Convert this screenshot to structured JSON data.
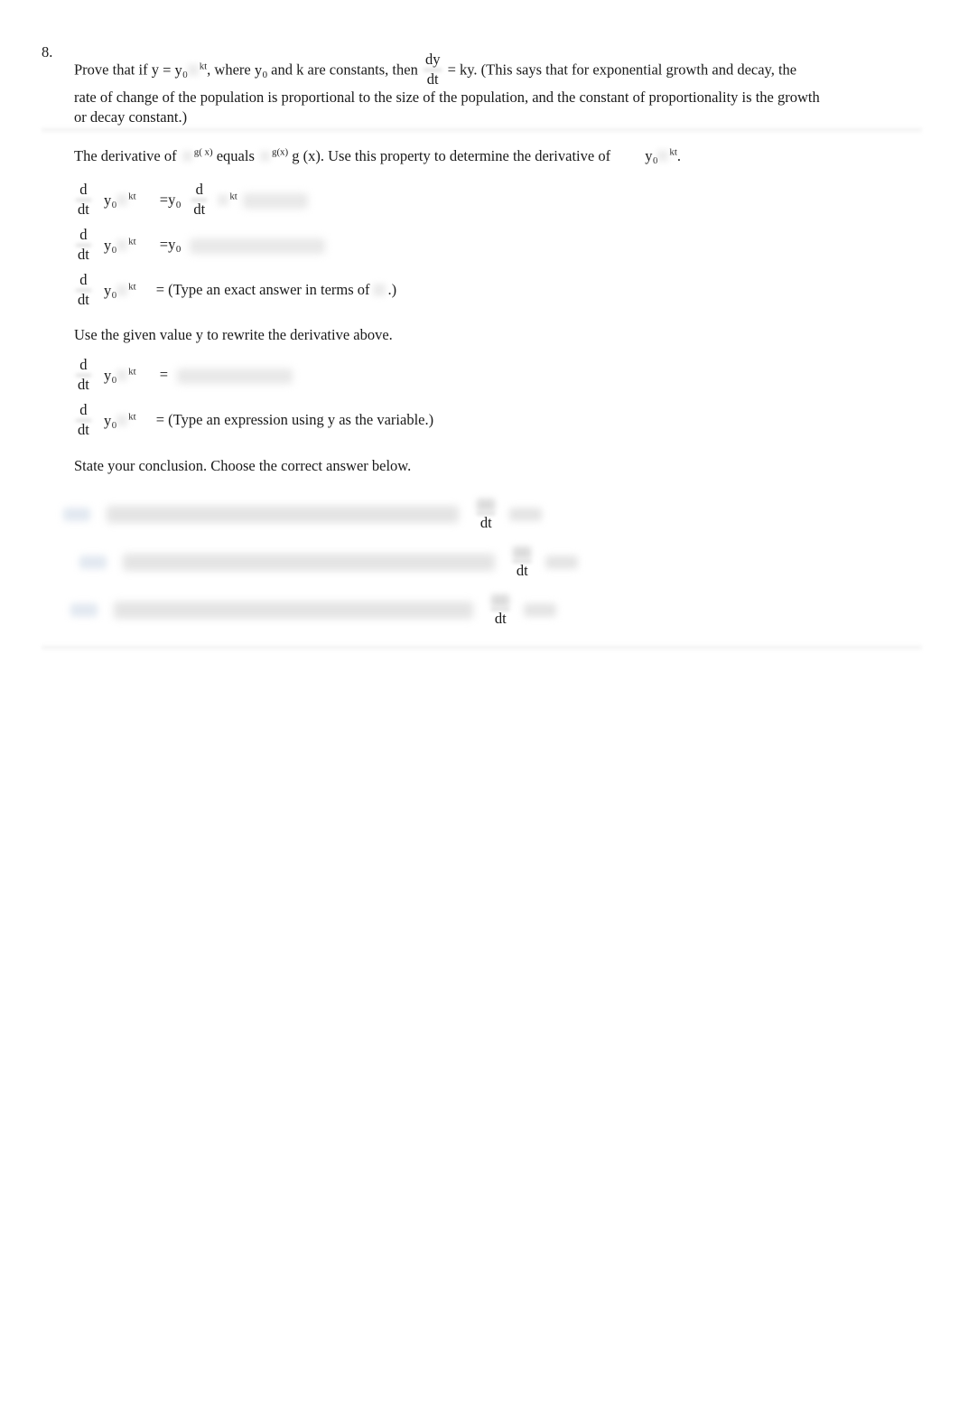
{
  "document": {
    "problem_number": "8.",
    "background_color": "#ffffff",
    "text_color": "#1a1a1a"
  },
  "prompt": {
    "line1_a": "Prove that if y",
    "line1_eq": "= y",
    "line1_sub": "0",
    "line1_sup": "kt",
    "line1_b": ", where",
    "line1_y0": "y",
    "line1_y0_sub": "0",
    "line1_c": "and k are constants, then",
    "dydt_num": "dy",
    "dydt_den": "dt",
    "line1_d": "= ky.  (This says that for exponential growth and decay, the",
    "line2": "rate of change of the population is proportional to the size of the population, and the constant of proportionality is the growth",
    "line3": "or decay constant.)"
  },
  "property": {
    "text_a": "The derivative of",
    "exp_sup": "g( x)",
    "text_equals": "equals",
    "exp_sup2": "g(x)",
    "text_b": "g",
    "text_c": "(x). Use this property to determine the derivative of",
    "target_y": "y",
    "target_sub": "0",
    "target_sup": "kt",
    "text_period": "."
  },
  "derivative_steps": {
    "d": "d",
    "dt": "dt",
    "y": "y",
    "y_sub": "0",
    "kt": "kt",
    "equals": "=",
    "step3_note": "= (Type an exact answer in terms of",
    "step3_note_end": ".)"
  },
  "rewrite": {
    "instruction": "Use the given value y to rewrite the derivative above.",
    "d": "d",
    "dt": "dt",
    "y": "y",
    "y_sub": "0",
    "kt": "kt",
    "equals": "=",
    "note": "= (Type an expression using y as the variable.)"
  },
  "conclusion": {
    "instruction": "State your conclusion. Choose the correct answer below.",
    "choices": [
      {
        "id": "choice-a",
        "denominator": "dt",
        "redacted": true
      },
      {
        "id": "choice-b",
        "denominator": "dt",
        "redacted": true
      },
      {
        "id": "choice-c",
        "denominator": "dt",
        "redacted": true
      }
    ]
  }
}
